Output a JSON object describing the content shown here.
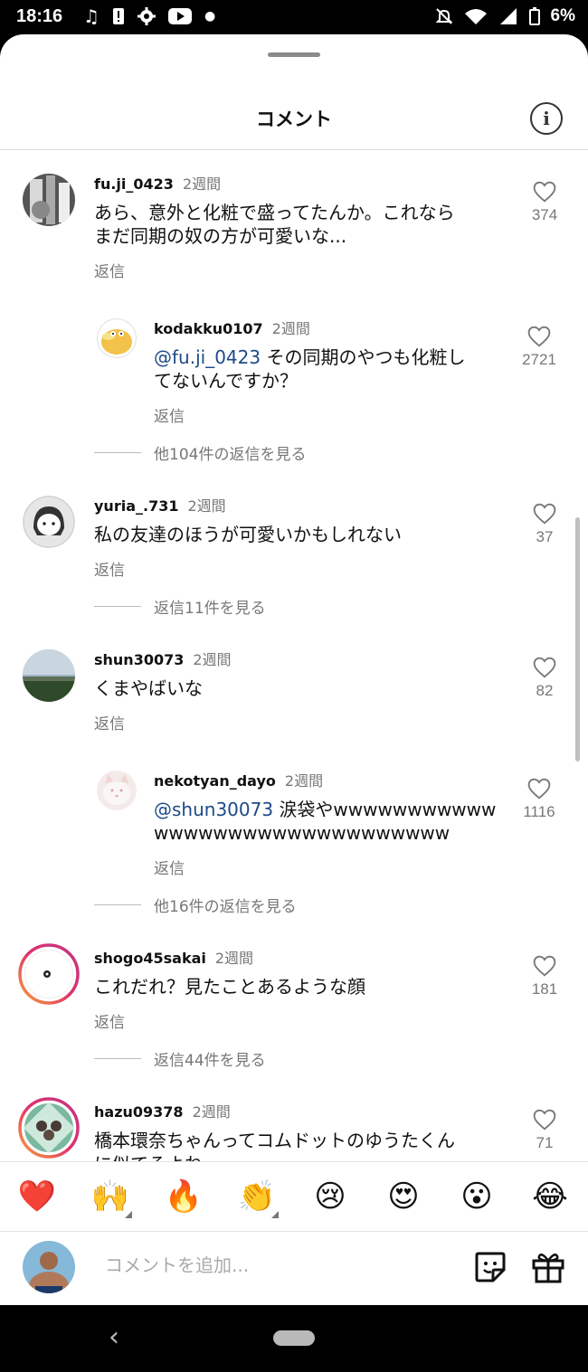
{
  "status_bar": {
    "time": "18:16",
    "battery": "6%",
    "left_icons": [
      "music-icon",
      "alert-icon",
      "settings-icon",
      "youtube-icon",
      "dot-icon"
    ],
    "right_icons": [
      "mute-icon",
      "wifi-icon",
      "signal-icon",
      "battery-icon"
    ]
  },
  "sheet": {
    "title": "コメント"
  },
  "comments": [
    {
      "username": "fu.ji_0423",
      "time": "2週間",
      "text_lines": [
        "あら、意外と化粧で盛ってたんか。これなら",
        "まだ同期の奴の方が可愛いな..."
      ],
      "reply_label": "返信",
      "likes": "374"
    },
    {
      "username": "kodakku0107",
      "time": "2週間",
      "mention": "@fu.ji_0423",
      "text_lines": [
        "その同期のやつも化粧し",
        "てないんですか？"
      ],
      "reply_label": "返信",
      "likes": "2721"
    },
    {
      "view_replies": "他104件の返信を見る"
    },
    {
      "username": "yuria_.731",
      "time": "2週間",
      "text_lines": [
        "私の友達のほうが可愛いかもしれない"
      ],
      "reply_label": "返信",
      "likes": "37"
    },
    {
      "view_replies": "返信11件を見る"
    },
    {
      "username": "shun30073",
      "time": "2週間",
      "text_lines": [
        "くまやばいな"
      ],
      "reply_label": "返信",
      "likes": "82"
    },
    {
      "username": "nekotyan_dayo",
      "time": "2週間",
      "mention": "@shun30073",
      "text_lines": [
        "涙袋やwwwwwwwwwww",
        "wwwwwwwwwwwwwwwwwwww"
      ],
      "reply_label": "返信",
      "likes": "1116"
    },
    {
      "view_replies": "他16件の返信を見る"
    },
    {
      "username": "shogo45sakai",
      "time": "2週間",
      "text_lines": [
        "これだれ？見たことあるような顔"
      ],
      "reply_label": "返信",
      "likes": "181"
    },
    {
      "view_replies": "返信44件を見る"
    },
    {
      "username": "hazu09378",
      "time": "2週間",
      "text_lines": [
        "橋本環奈ちゃんってコムドットのゆうたくん",
        "に似てるよね"
      ],
      "likes": "71"
    }
  ],
  "emoji_bar": [
    "❤️",
    "🙌",
    "🔥",
    "👏",
    "😢",
    "😍",
    "😮",
    "😂"
  ],
  "input": {
    "placeholder": "コメントを追加..."
  },
  "colors": {
    "mention": "#1e4a87",
    "story_ring_start": "#e1306c",
    "story_ring_end": "#f7a23b"
  }
}
